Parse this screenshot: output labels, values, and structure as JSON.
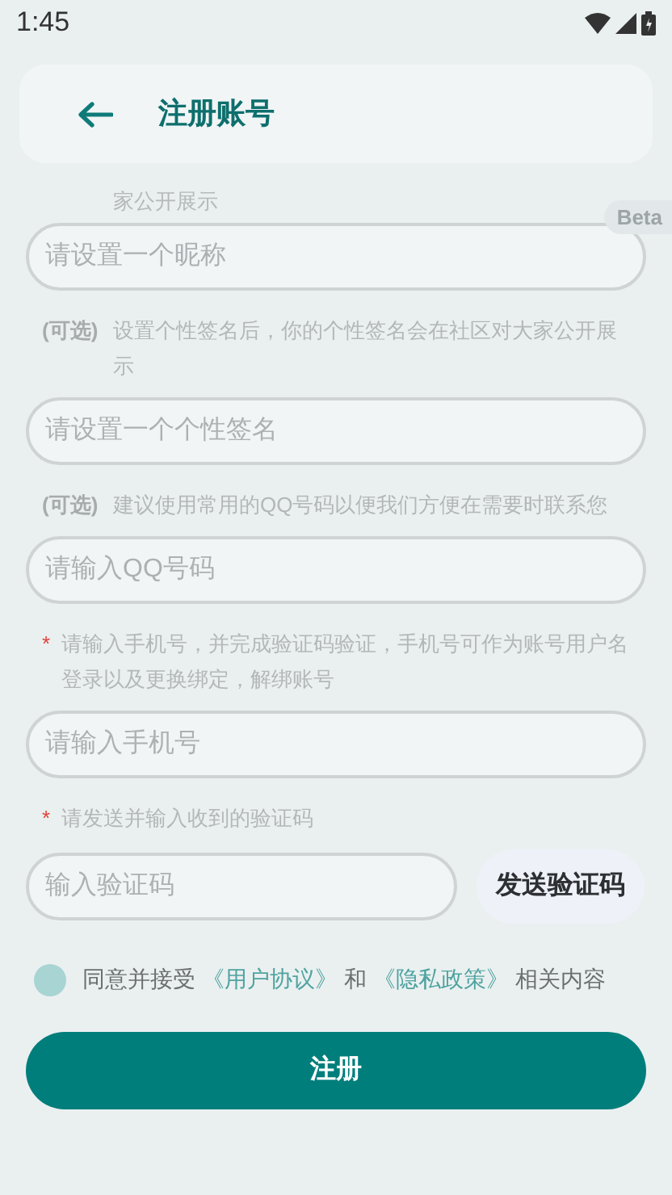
{
  "status_bar": {
    "time": "1:45"
  },
  "header": {
    "title": "注册账号"
  },
  "clipped_hint": "家公开展示",
  "beta_badge": "Beta",
  "sections": [
    {
      "field": {
        "placeholder": "请设置一个昵称"
      }
    },
    {
      "hint": {
        "kind": "optional",
        "tag": "(可选)",
        "text": "设置个性签名后，你的个性签名会在社区对大家公开展示"
      },
      "field": {
        "placeholder": "请设置一个个性签名"
      }
    },
    {
      "hint": {
        "kind": "optional",
        "tag": "(可选)",
        "text": "建议使用常用的QQ号码以便我们方便在需要时联系您"
      },
      "field": {
        "placeholder": "请输入QQ号码"
      }
    },
    {
      "hint": {
        "kind": "required",
        "tag": "*",
        "text": "请输入手机号，并完成验证码验证，手机号可作为账号用户名登录以及更换绑定，解绑账号"
      },
      "field": {
        "placeholder": "请输入手机号"
      }
    },
    {
      "hint": {
        "kind": "required",
        "tag": "*",
        "text": "请发送并输入收到的验证码"
      },
      "field": {
        "placeholder": "输入验证码"
      },
      "button": "发送验证码"
    }
  ],
  "agreement": {
    "checked": false,
    "parts": [
      {
        "kind": "text",
        "text": "同意并接受"
      },
      {
        "kind": "link",
        "text": "《用户协议》"
      },
      {
        "kind": "text",
        "text": "和"
      },
      {
        "kind": "link",
        "text": "《隐私政策》"
      },
      {
        "kind": "text",
        "text": "相关内容"
      }
    ]
  },
  "submit": "注册"
}
